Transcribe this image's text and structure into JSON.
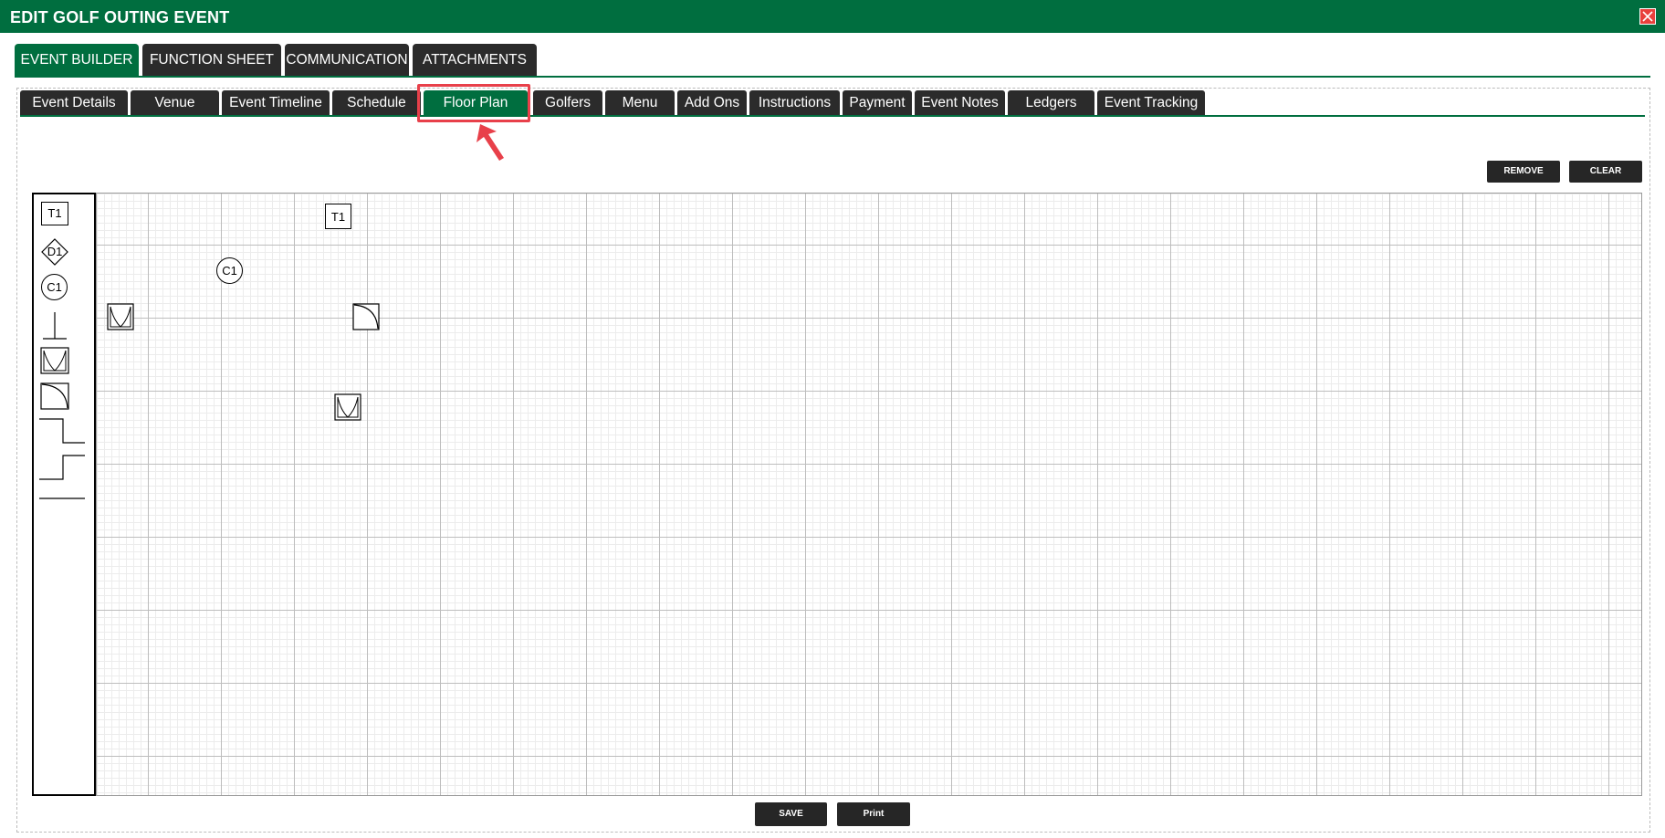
{
  "window": {
    "title": "EDIT GOLF OUTING EVENT",
    "close_icon": "close-icon"
  },
  "main_tabs": [
    {
      "label": "EVENT BUILDER",
      "active": true
    },
    {
      "label": "FUNCTION SHEET",
      "active": false
    },
    {
      "label": "COMMUNICATION",
      "active": false
    },
    {
      "label": "ATTACHMENTS",
      "active": false
    }
  ],
  "sub_tabs": [
    {
      "label": "Event Details",
      "active": false
    },
    {
      "label": "Venue",
      "active": false
    },
    {
      "label": "Event Timeline",
      "active": false
    },
    {
      "label": "Schedule",
      "active": false
    },
    {
      "label": "Floor Plan",
      "active": true
    },
    {
      "label": "Golfers",
      "active": false
    },
    {
      "label": "Menu",
      "active": false
    },
    {
      "label": "Add Ons",
      "active": false
    },
    {
      "label": "Instructions",
      "active": false
    },
    {
      "label": "Payment",
      "active": false
    },
    {
      "label": "Event Notes",
      "active": false
    },
    {
      "label": "Ledgers",
      "active": false
    },
    {
      "label": "Event Tracking",
      "active": false
    }
  ],
  "floor_plan": {
    "remove_label": "REMOVE",
    "clear_label": "CLEAR",
    "palette": {
      "table_label": "T1",
      "diamond_label": "D1",
      "circle_label": "C1"
    },
    "placed": {
      "table_label": "T1",
      "circle_label": "C1"
    }
  },
  "footer": {
    "save_label": "SAVE",
    "print_label": "Print"
  },
  "colors": {
    "brand_green": "#006e3f",
    "tab_dark": "#2b2b2b",
    "highlight_red": "#e8404a",
    "close_red": "#e8403c"
  }
}
